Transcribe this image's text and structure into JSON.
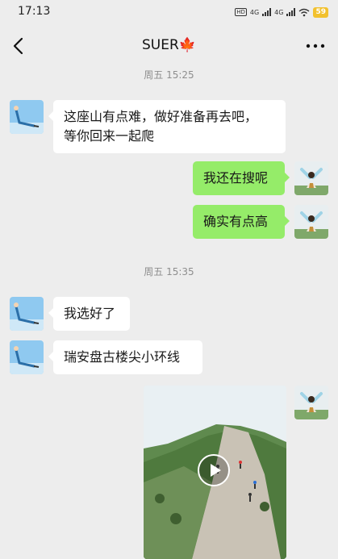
{
  "status": {
    "time": "17:13",
    "network_1": "4G",
    "network_2": "4G",
    "hd": "HD",
    "battery": "59"
  },
  "header": {
    "title": "SUER🍁",
    "back_icon": "chevron-left-icon",
    "more_icon": "more-dots-icon"
  },
  "messages": [
    {
      "type": "timestamp",
      "text": "周五 15:25"
    },
    {
      "type": "text",
      "side": "left",
      "text": "这座山有点难，做好准备再去吧，\n等你回来一起爬"
    },
    {
      "type": "text",
      "side": "right",
      "text": "我还在搜呢"
    },
    {
      "type": "text",
      "side": "right",
      "text": "确实有点高"
    },
    {
      "type": "timestamp",
      "text": "周五 15:35"
    },
    {
      "type": "text",
      "side": "left",
      "text": "我选好了"
    },
    {
      "type": "text",
      "side": "left",
      "text": "瑞安盘古楼尖小环线"
    },
    {
      "type": "video",
      "side": "right",
      "icon": "play-icon"
    }
  ],
  "colors": {
    "background": "#ededed",
    "bubble_self": "#95ec69",
    "bubble_other": "#ffffff",
    "timestamp": "#8e8e8e",
    "battery": "#f2c12e"
  }
}
